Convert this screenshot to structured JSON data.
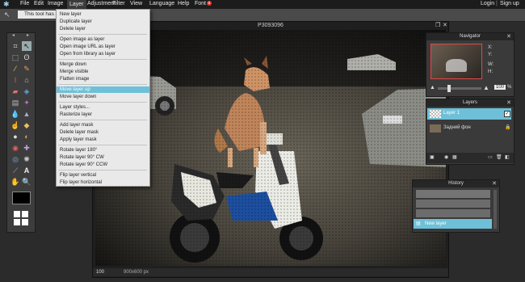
{
  "menubar": {
    "items": [
      "File",
      "Edit",
      "Image",
      "Layer",
      "Adjustment",
      "Filter",
      "View",
      "Language",
      "Help",
      "Font"
    ],
    "font_badge": "a",
    "login": "Login",
    "separator": "|",
    "signup": "Sign up"
  },
  "options": {
    "tip": "This tool has no options"
  },
  "canvas": {
    "title": "P3093096",
    "zoom": "100",
    "size": "900x600 px"
  },
  "layer_menu": {
    "items": [
      "New layer",
      "Duplicate layer",
      "Delete layer",
      "Open image as layer",
      "Open image URL as layer",
      "Open from library as layer",
      "Merge down",
      "Merge visible",
      "Flatten image",
      "Move layer up",
      "Move layer down",
      "Layer styles...",
      "Rasterize layer",
      "Add layer mask",
      "Delete layer mask",
      "Apply layer mask",
      "Rotate layer 180°",
      "Rotate layer 90° CW",
      "Rotate layer 90° CCW",
      "Flip layer vertical",
      "Flip layer horizontal"
    ],
    "highlighted": "Move layer up"
  },
  "navigator": {
    "title": "Navigator",
    "x_label": "X:",
    "y_label": "Y:",
    "w_label": "W:",
    "h_label": "H:",
    "zoom": "100",
    "zoom_unit": "%"
  },
  "layers": {
    "title": "Layers",
    "items": [
      {
        "name": "Layer 1"
      },
      {
        "name": "Задний фон"
      }
    ]
  },
  "history": {
    "title": "History",
    "items": [
      "New layer"
    ],
    "active": "New layer"
  },
  "colors": {
    "accent": "#6ec0d8",
    "menu_bg": "#1c1c1c",
    "panel_bg": "#3a3a3a",
    "badge": "#e0342b"
  }
}
